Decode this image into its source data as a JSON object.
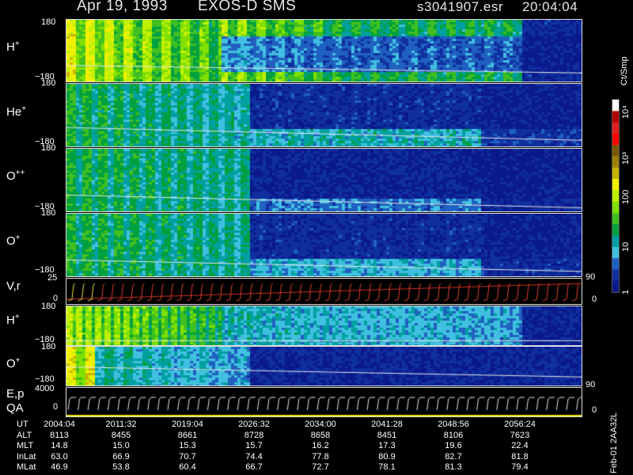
{
  "header": {
    "date": "Apr 19, 1993",
    "instrument": "EXOS-D SMS",
    "file": "s3041907.esr",
    "time": "20:04:04"
  },
  "panels": [
    {
      "id": "h-plus-1",
      "label": "H",
      "sup": "+",
      "top_tick": "180",
      "bottom_tick": "−180"
    },
    {
      "id": "he-plus",
      "label": "He",
      "sup": "+",
      "top_tick": "180",
      "bottom_tick": "−180"
    },
    {
      "id": "o-plus-plus",
      "label": "O",
      "sup": "++",
      "top_tick": "180",
      "bottom_tick": "−180"
    },
    {
      "id": "o-plus-1",
      "label": "O",
      "sup": "+",
      "top_tick": "180",
      "bottom_tick": "−180"
    },
    {
      "id": "vr",
      "label": "V,r",
      "sup": "",
      "top_tick": "25",
      "bottom_tick": "0",
      "right_top": "90",
      "right_bottom": "0"
    },
    {
      "id": "h-plus-2",
      "label": "H",
      "sup": "+",
      "top_tick": "180",
      "bottom_tick": "−180"
    },
    {
      "id": "o-plus-2",
      "label": "O",
      "sup": "+",
      "top_tick": "180",
      "bottom_tick": "−180",
      "right_bottom": "90"
    },
    {
      "id": "ep-qa",
      "label": "E,p",
      "label2": "QA",
      "sup": "",
      "top_tick": "4000",
      "bottom_tick": "0",
      "right_bottom": "0"
    }
  ],
  "colorbar": {
    "units": "Ct/Smp",
    "ticks": [
      "10⁴",
      "10³",
      "100",
      "10",
      "1"
    ],
    "colors": [
      "#ffffff",
      "#b00000",
      "#e02020",
      "#ff0000",
      "#7a5a00",
      "#a08000",
      "#c8b400",
      "#f0f000",
      "#c0f000",
      "#80e000",
      "#40c020",
      "#00a040",
      "#00a0a0",
      "#40c0e0",
      "#2060c0",
      "#1030a0",
      "#0a1a8c"
    ]
  },
  "ephemeris": {
    "headers": [
      "UT",
      "ALT",
      "MLT",
      "InLat",
      "MLat"
    ],
    "columns": [
      [
        "2004:04",
        "8113",
        "14.8",
        "63.0",
        "46.9"
      ],
      [
        "2011:32",
        "8455",
        "15.0",
        "66.9",
        "53.8"
      ],
      [
        "2019:04",
        "8661",
        "15.3",
        "70.7",
        "60.4"
      ],
      [
        "2026:32",
        "8728",
        "15.7",
        "74.4",
        "66.7"
      ],
      [
        "2034:00",
        "8658",
        "16.2",
        "77.8",
        "72.7"
      ],
      [
        "2041:28",
        "8451",
        "17.3",
        "80.9",
        "78.1"
      ],
      [
        "2048:56",
        "8106",
        "19.6",
        "82.7",
        "81.3"
      ],
      [
        "2056:24",
        "7623",
        "22.4",
        "81.8",
        "79.4"
      ]
    ]
  },
  "footer": {
    "generated": "Feb-01 2AA32L"
  }
}
